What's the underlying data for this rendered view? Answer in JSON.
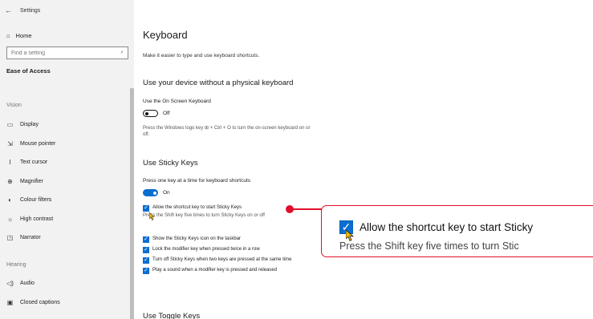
{
  "window": {
    "back_glyph": "←",
    "title": "Settings"
  },
  "sidebar": {
    "home_label": "Home",
    "search_placeholder": "Find a setting",
    "section_title": "Ease of Access",
    "groups": {
      "vision": "Vision",
      "hearing": "Hearing"
    },
    "vision_items": [
      {
        "icon": "display-icon",
        "glyph": "▭",
        "label": "Display"
      },
      {
        "icon": "mouse-pointer-icon",
        "glyph": "⇲",
        "label": "Mouse pointer"
      },
      {
        "icon": "text-cursor-icon",
        "glyph": "I",
        "label": "Text cursor"
      },
      {
        "icon": "magnifier-icon",
        "glyph": "⊕",
        "label": "Magnifier"
      },
      {
        "icon": "colour-filters-icon",
        "glyph": "◐",
        "label": "Colour filters"
      },
      {
        "icon": "high-contrast-icon",
        "glyph": "☼",
        "label": "High contrast"
      },
      {
        "icon": "narrator-icon",
        "glyph": "◳",
        "label": "Narrator"
      }
    ],
    "hearing_items": [
      {
        "icon": "audio-icon",
        "glyph": "◁)",
        "label": "Audio"
      },
      {
        "icon": "closed-captions-icon",
        "glyph": "▣",
        "label": "Closed captions"
      }
    ]
  },
  "main": {
    "title": "Keyboard",
    "subtitle": "Make it easier to type and use keyboard shortcuts.",
    "osk": {
      "heading": "Use your device without a physical keyboard",
      "label": "Use the On Screen Keyboard",
      "state": "Off",
      "desc": "Press the Windows logo key ⊞ + Ctrl + O to turn the on-screen keyboard on or off."
    },
    "sticky": {
      "heading": "Use Sticky Keys",
      "label": "Press one key at a time for keyboard shortcuts",
      "state": "On",
      "shortcut_check": "Allow the shortcut key to start Sticky Keys",
      "shortcut_desc": "Press the Shift key five times to turn Sticky Keys on or off",
      "options": [
        "Show the Sticky Keys icon on the taskbar",
        "Lock the modifier key when pressed twice in a row",
        "Turn off Sticky Keys when two keys are pressed at the same time",
        "Play a sound when a modifier key is pressed and released"
      ]
    },
    "toggle_keys": {
      "heading": "Use Toggle Keys"
    }
  },
  "callout": {
    "check_text": "Allow the shortcut key to start Sticky",
    "desc_text": "Press the Shift key five times to turn Stic"
  },
  "colors": {
    "accent": "#0a6ed1",
    "highlight": "#e0102a"
  }
}
